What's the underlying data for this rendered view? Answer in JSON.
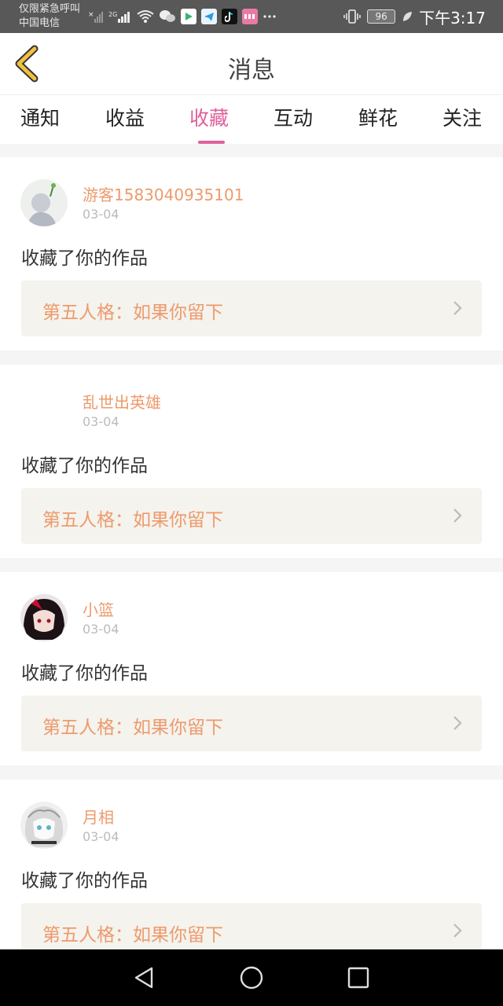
{
  "status_bar": {
    "line1": "仅限紧急呼叫",
    "line2": "中国电信",
    "network": "2G",
    "battery": "96",
    "time": "下午3:17",
    "icons": [
      "signal-off-icon",
      "signal-icon",
      "wifi-icon",
      "wechat-icon",
      "video-app-icon",
      "telegram-icon",
      "tiktok-icon",
      "lofter-icon",
      "more-icon",
      "vibrate-icon",
      "leaf-icon"
    ]
  },
  "header": {
    "title": "消息"
  },
  "tabs": [
    {
      "label": "通知",
      "active": false
    },
    {
      "label": "收益",
      "active": false
    },
    {
      "label": "收藏",
      "active": true
    },
    {
      "label": "互动",
      "active": false
    },
    {
      "label": "鲜花",
      "active": false
    },
    {
      "label": "关注",
      "active": false
    }
  ],
  "feed": [
    {
      "name": "游客1583040935101",
      "date": "03-04",
      "action": "收藏了你的作品",
      "work": "第五人格：如果你留下"
    },
    {
      "name": "乱世出英雄",
      "date": "03-04",
      "action": "收藏了你的作品",
      "work": "第五人格：如果你留下"
    },
    {
      "name": "小篮",
      "date": "03-04",
      "action": "收藏了你的作品",
      "work": "第五人格：如果你留下"
    },
    {
      "name": "月相",
      "date": "03-04",
      "action": "收藏了你的作品",
      "work": "第五人格：如果你留下"
    }
  ],
  "colors": {
    "accent": "#e0609a",
    "username": "#ee9a6c",
    "back_arrow": "#f0c040"
  }
}
